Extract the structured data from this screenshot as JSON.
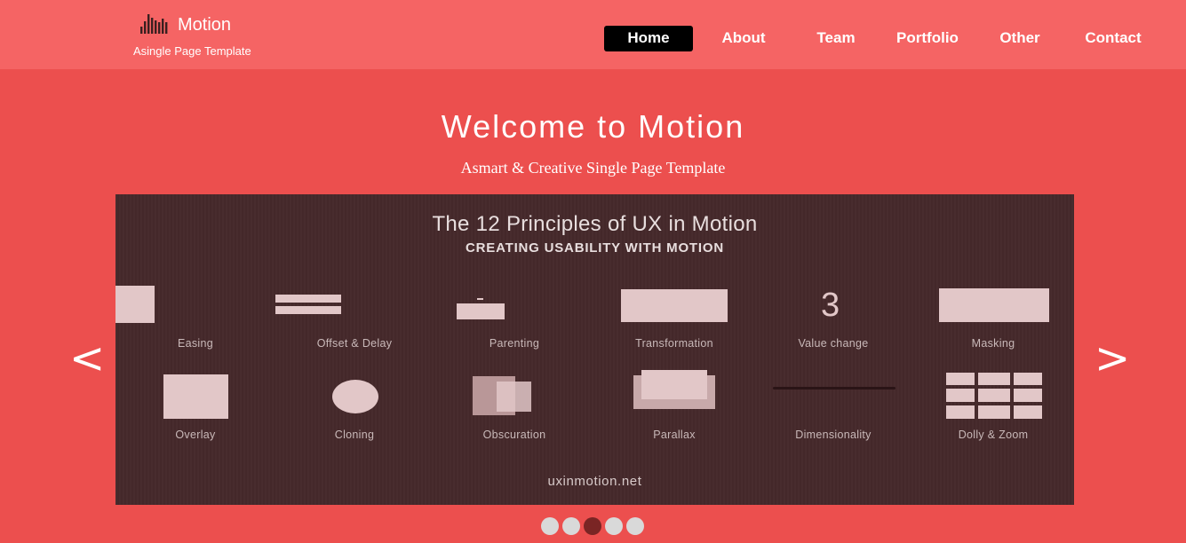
{
  "header": {
    "brand": "Motion",
    "tagline": "Asingle Page Template",
    "logo_icon": "bar-chart-icon",
    "nav": [
      {
        "label": "Home",
        "active": true
      },
      {
        "label": "About"
      },
      {
        "label": "Team"
      },
      {
        "label": "Portfolio"
      },
      {
        "label": "Other"
      },
      {
        "label": "Contact"
      }
    ]
  },
  "hero": {
    "title": "Welcome to Motion",
    "subtitle": "Asmart & Creative Single Page Template"
  },
  "slider": {
    "prev_label": "<",
    "next_label": ">",
    "current_index": 3,
    "total": 5,
    "slide": {
      "title": "The 12 Principles of UX in Motion",
      "subtitle": "CREATING USABILITY WITH MOTION",
      "value_number": "3",
      "principles": [
        "Easing",
        "Offset & Delay",
        "Parenting",
        "Transformation",
        "Value change",
        "Masking",
        "Overlay",
        "Cloning",
        "Obscuration",
        "Parallax",
        "Dimensionality",
        "Dolly & Zoom"
      ],
      "url": "uxinmotion.net"
    }
  },
  "colors": {
    "page_background": "#ec4f4e",
    "header_background": "#f56464",
    "active_nav": "#000000",
    "slide_background": "#44282a",
    "active_dot": "#7a2524",
    "inactive_dot": "#d9d9d9"
  }
}
